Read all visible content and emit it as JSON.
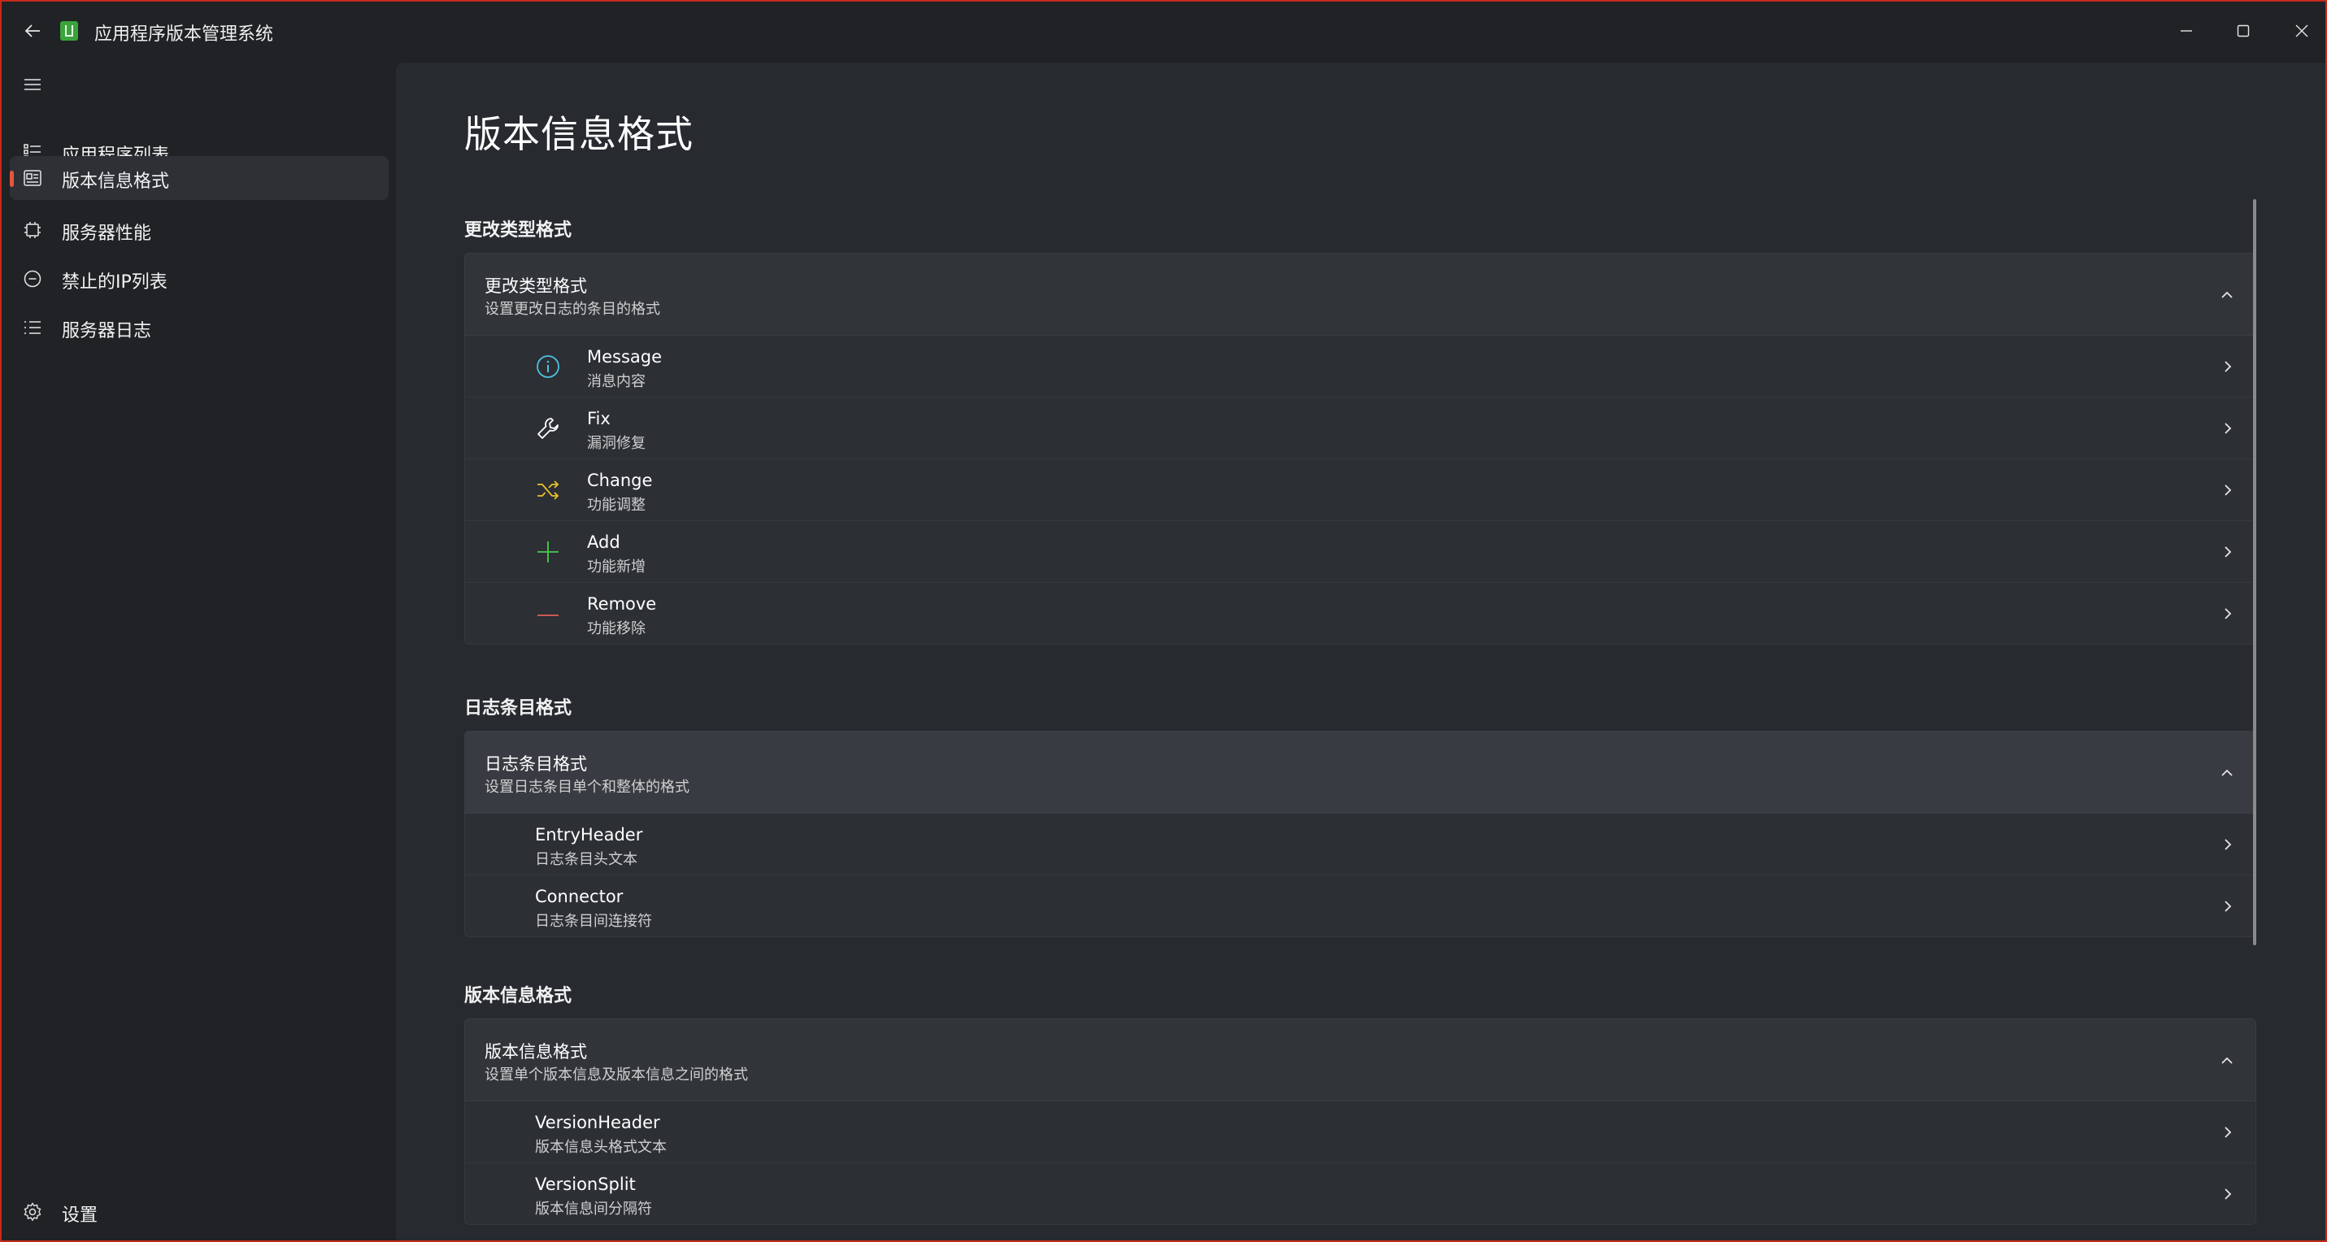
{
  "app": {
    "title": "应用程序版本管理系统"
  },
  "sidebar": {
    "items": [
      {
        "label": "应用程序列表",
        "icon": "bullet-list-icon"
      },
      {
        "label": "版本信息格式",
        "icon": "format-card-icon"
      },
      {
        "label": "服务器性能",
        "icon": "cpu-chip-icon"
      },
      {
        "label": "禁止的IP列表",
        "icon": "block-circle-icon"
      },
      {
        "label": "服务器日志",
        "icon": "list-icon"
      }
    ],
    "settings_label": "设置"
  },
  "main": {
    "page_title": "版本信息格式",
    "sections": [
      {
        "heading": "更改类型格式",
        "header_title": "更改类型格式",
        "header_subtitle": "设置更改日志的条目的格式",
        "rows": [
          {
            "title": "Message",
            "subtitle": "消息内容",
            "icon": "info-icon",
            "color": "#4cc2e0"
          },
          {
            "title": "Fix",
            "subtitle": "漏洞修复",
            "icon": "wrench-icon",
            "color": "#ffffff"
          },
          {
            "title": "Change",
            "subtitle": "功能调整",
            "icon": "shuffle-icon",
            "color": "#e8c22a"
          },
          {
            "title": "Add",
            "subtitle": "功能新增",
            "icon": "plus-icon",
            "color": "#4ccc4c"
          },
          {
            "title": "Remove",
            "subtitle": "功能移除",
            "icon": "minus-icon",
            "color": "#e0605a"
          }
        ]
      },
      {
        "heading": "日志条目格式",
        "header_title": "日志条目格式",
        "header_subtitle": "设置日志条目单个和整体的格式",
        "rows": [
          {
            "title": "EntryHeader",
            "subtitle": "日志条目头文本"
          },
          {
            "title": "Connector",
            "subtitle": "日志条目间连接符"
          }
        ]
      },
      {
        "heading": "版本信息格式",
        "header_title": "版本信息格式",
        "header_subtitle": "设置单个版本信息及版本信息之间的格式",
        "rows": [
          {
            "title": "VersionHeader",
            "subtitle": "版本信息头格式文本"
          },
          {
            "title": "VersionSplit",
            "subtitle": "版本信息间分隔符"
          }
        ]
      }
    ]
  },
  "colors": {
    "accent": "#e8553a",
    "window_border": "#c42b1c"
  }
}
